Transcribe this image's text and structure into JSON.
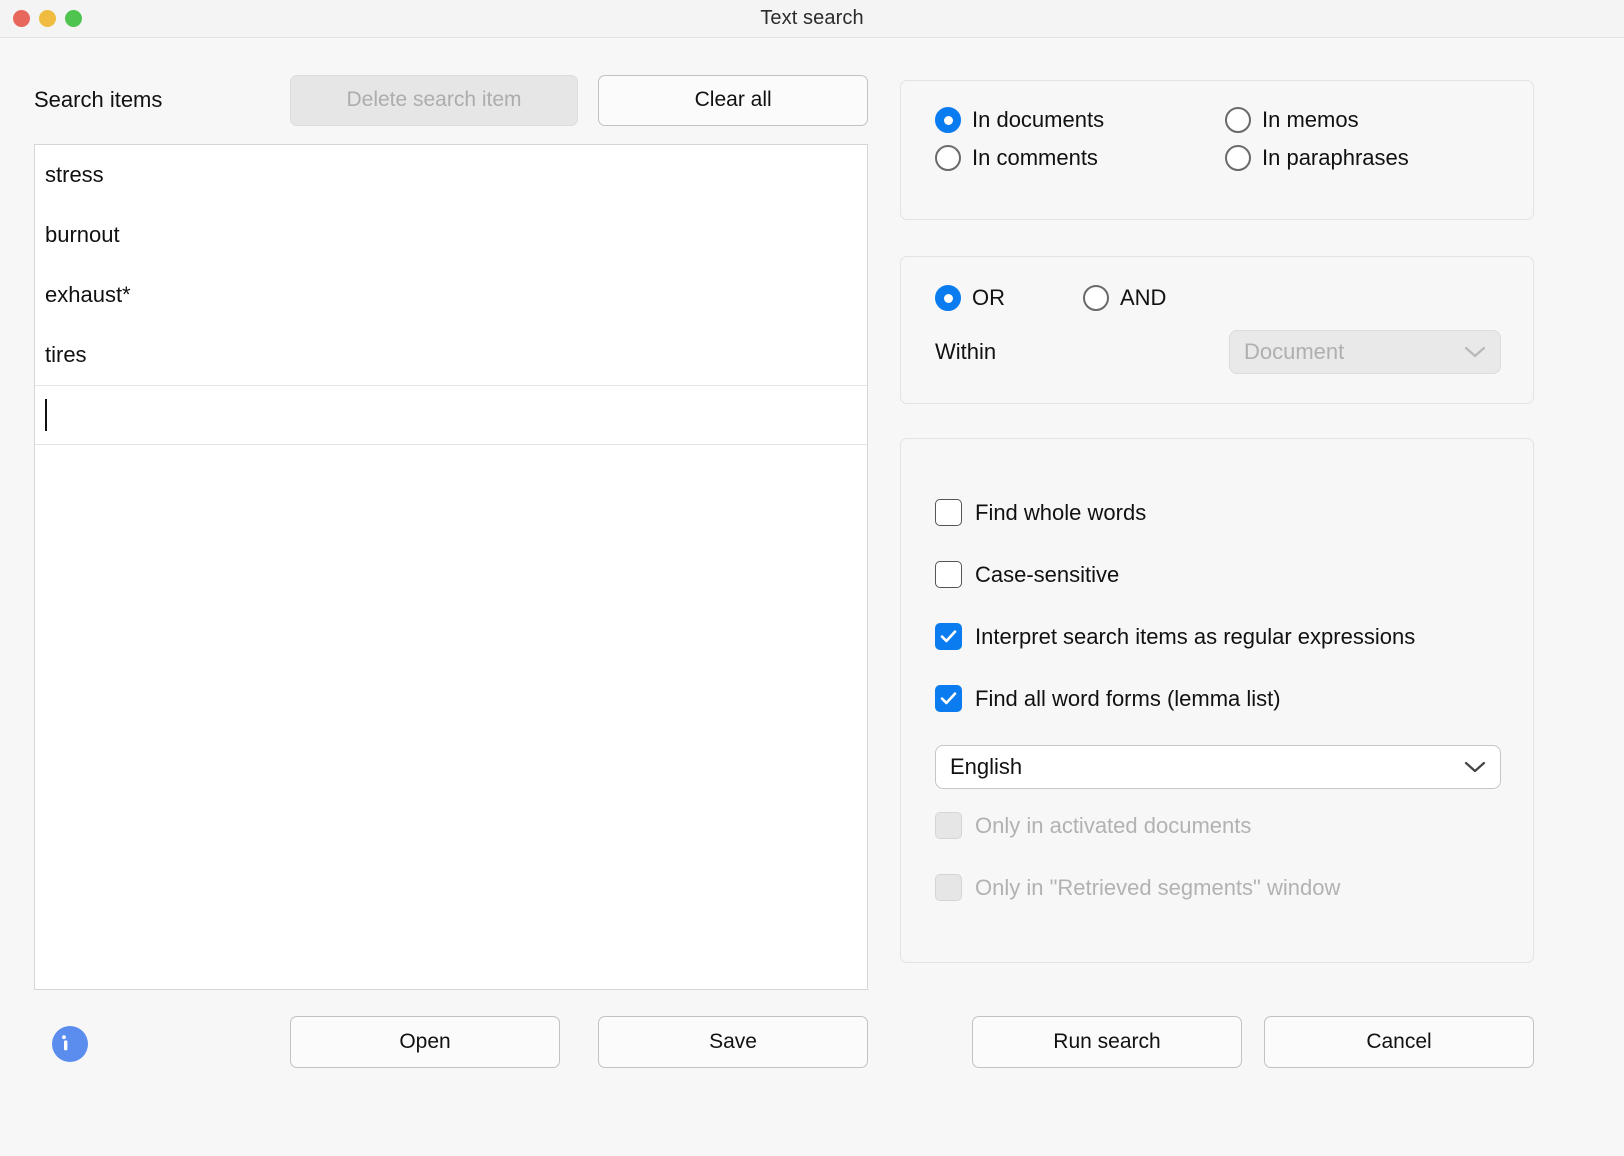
{
  "window": {
    "title": "Text search",
    "traffic_lights": [
      "close-button",
      "minimize-button",
      "maximize-button"
    ],
    "accent_blue": "#0a7cf0",
    "info_blue": "#5b8def"
  },
  "left": {
    "label": "Search items",
    "delete_button": "Delete search item",
    "clear_button": "Clear all",
    "items": [
      "stress",
      "burnout",
      "exhaust*",
      "tires"
    ],
    "edit_value": "",
    "open_button": "Open",
    "save_button": "Save"
  },
  "scope": {
    "options": [
      {
        "label": "In documents",
        "selected": true
      },
      {
        "label": "In memos",
        "selected": false
      },
      {
        "label": "In comments",
        "selected": false
      },
      {
        "label": "In paraphrases",
        "selected": false
      }
    ]
  },
  "logic": {
    "options": [
      {
        "label": "OR",
        "selected": true
      },
      {
        "label": "AND",
        "selected": false
      }
    ],
    "within_label": "Within",
    "within_value": "Document",
    "within_enabled": false
  },
  "options": {
    "find_whole_words": {
      "label": "Find whole words",
      "checked": false,
      "enabled": true
    },
    "case_sensitive": {
      "label": "Case-sensitive",
      "checked": false,
      "enabled": true
    },
    "regex": {
      "label": "Interpret search items as regular expressions",
      "checked": true,
      "enabled": true
    },
    "lemma": {
      "label": "Find all word forms (lemma list)",
      "checked": true,
      "enabled": true
    },
    "language_value": "English",
    "only_activated": {
      "label": "Only in activated documents",
      "checked": false,
      "enabled": false
    },
    "only_retrieved": {
      "label": "Only in \"Retrieved segments\" window",
      "checked": false,
      "enabled": false
    }
  },
  "actions": {
    "run_search": "Run search",
    "cancel": "Cancel"
  }
}
